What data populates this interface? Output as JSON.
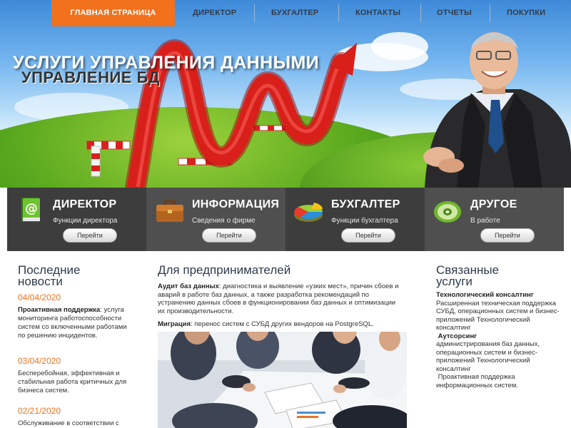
{
  "nav": {
    "items": [
      {
        "label": "ГЛАВНАЯ СТРАНИЦА",
        "active": true
      },
      {
        "label": "ДИРЕКТОР"
      },
      {
        "label": "БУХГАЛТЕР"
      },
      {
        "label": "КОНТАКТЫ"
      },
      {
        "label": "ОТЧЕТЫ"
      },
      {
        "label": "ПОКУПКИ"
      }
    ]
  },
  "hero": {
    "title": "УСЛУГИ УПРАВЛЕНИЯ ДАННЫМИ",
    "subtitle": "УПРАВЛЕНИЕ БД"
  },
  "features": [
    {
      "title": "ДИРЕКТОР",
      "desc": "Функции директора",
      "button": "Перейти",
      "icon": "email-book-icon",
      "bg": "#3d3d3d"
    },
    {
      "title": "ИНФОРМАЦИЯ",
      "desc": "Сведения о фирме",
      "button": "Перейти",
      "icon": "briefcase-icon",
      "bg": "#4f4f4f"
    },
    {
      "title": "БУХГАЛТЕР",
      "desc": "Функции бухгалтера",
      "button": "Перейти",
      "icon": "pie-chart-icon",
      "bg": "#3d3d3d"
    },
    {
      "title": "ДРУГОЕ",
      "desc": "В работе",
      "button": "Перейти",
      "icon": "disc-icon",
      "bg": "#4f4f4f"
    }
  ],
  "news": {
    "heading_line1": "Последние",
    "heading_line2": "новости",
    "items": [
      {
        "date": "04/04/2020",
        "bold": "Проактивная поддержка",
        "text": ": услуга мониторинга работоспособности систем со включенными работами по решению инцидентов."
      },
      {
        "date": "03/04/2020",
        "bold": "",
        "text": "Бесперебойная, эффективная и стабильная работа критичных для бизнеса систем."
      },
      {
        "date": "02/21/2020",
        "bold": "",
        "text": "Обслуживание в соответствии с"
      }
    ]
  },
  "main": {
    "heading": "Для предпринимателей",
    "p1_bold": "Аудит баз данных",
    "p1_text": ": диагностика и выявление «узких мест», причин сбоев и аварий в работе баз данных, а также разработка рекомендаций по устранению данных сбоев в функционировании баз данных и оптимизации их производительности.",
    "p2_bold": "Миграция",
    "p2_text": ": перенос систем с СУБД других вендоров на PostgreSQL.",
    "photo_alt": "business-meeting-photo"
  },
  "related": {
    "heading_line1": "Связанные",
    "heading_line2": "услуги",
    "b1": "Технологический консалтинг",
    "t1": "Расширенная техническая поддержка СУБД, операционных систем и бизнес-приложений Технологический консалтинг",
    "b2": "Аутсорсинг",
    "t2": "администрирования баз данных, операционных систем и бизнес-приложений Технологический консалтинг",
    "t3": "Проактивная поддержка информационных систем."
  },
  "colors": {
    "accent": "#f2711c",
    "nav_text": "#2f3b4c",
    "feature_dark": "#3d3d3d",
    "feature_light": "#4f4f4f",
    "arrow_red": "#d81f1a"
  }
}
